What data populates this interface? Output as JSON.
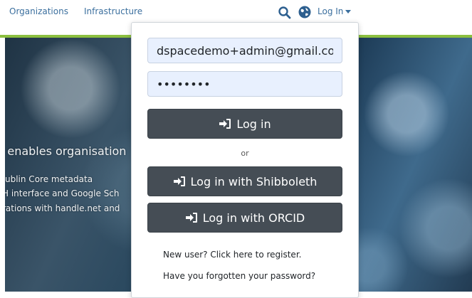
{
  "nav": {
    "organizations": "Organizations",
    "infrastructure": "Infrastructure",
    "login_label": "Log In",
    "icons": [
      "search-icon",
      "globe-icon",
      "chevron-down-icon"
    ]
  },
  "hero": {
    "line1": "t enables organisation",
    "line2": "ublin Core metadata",
    "line3": "H interface and Google Sch",
    "line4": "rations with handle.net and"
  },
  "login_form": {
    "email_value": "dspacedemo+admin@gmail.com",
    "password_value": "password",
    "login_button": "Log in",
    "or_label": "or",
    "shibboleth_button": "Log in with Shibboleth",
    "orcid_button": "Log in with ORCID",
    "register_link": "New user? Click here to register.",
    "forgot_link": "Have you forgotten your password?"
  },
  "colors": {
    "accent_green": "#8cbf3f",
    "button_dark": "#454d55",
    "link_blue": "#3b6f9e",
    "field_autofill": "#e8f0fe"
  }
}
